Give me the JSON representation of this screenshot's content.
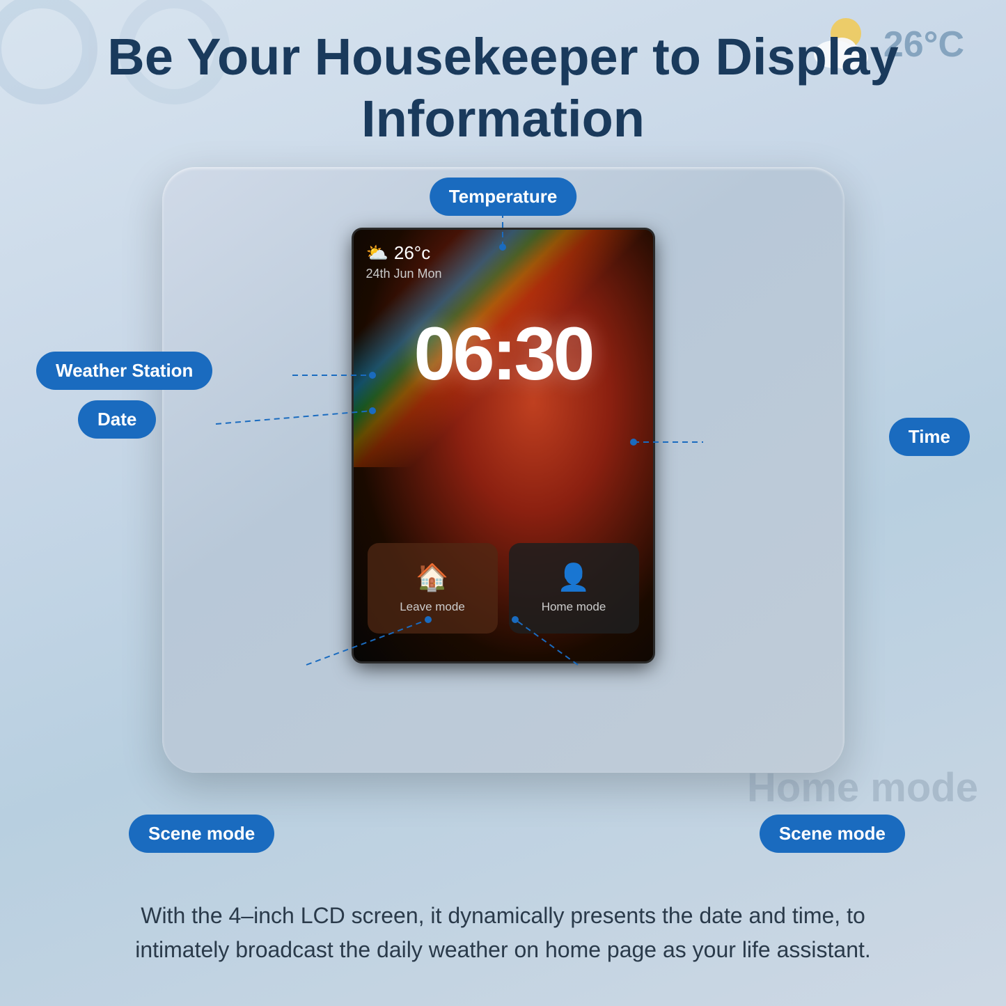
{
  "page": {
    "title_line1": "Be Your Housekeeper to Display",
    "title_line2": "Information"
  },
  "bg": {
    "weather_temp": "26°C"
  },
  "screen": {
    "temperature": "26°c",
    "date": "24th Jun Mon",
    "time": "06:30",
    "leave_mode_label": "Leave mode",
    "home_mode_label": "Home mode"
  },
  "annotations": {
    "temperature": "Temperature",
    "weather_station": "Weather Station",
    "date": "Date",
    "time": "Time",
    "scene_mode_left": "Scene mode",
    "scene_mode_right": "Scene mode"
  },
  "bottom_text": "With the 4–inch LCD screen, it dynamically presents the date and time, to intimately broadcast the daily weather on home page as your life assistant."
}
